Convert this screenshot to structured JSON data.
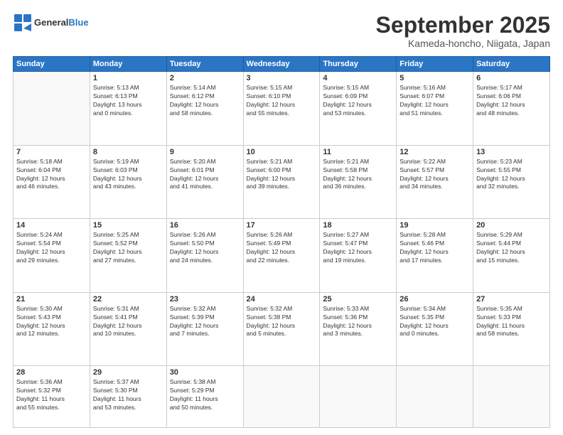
{
  "header": {
    "logo_general": "General",
    "logo_blue": "Blue",
    "month_title": "September 2025",
    "location": "Kameda-honcho, Niigata, Japan"
  },
  "weekdays": [
    "Sunday",
    "Monday",
    "Tuesday",
    "Wednesday",
    "Thursday",
    "Friday",
    "Saturday"
  ],
  "weeks": [
    [
      {
        "day": "",
        "info": ""
      },
      {
        "day": "1",
        "info": "Sunrise: 5:13 AM\nSunset: 6:13 PM\nDaylight: 13 hours\nand 0 minutes."
      },
      {
        "day": "2",
        "info": "Sunrise: 5:14 AM\nSunset: 6:12 PM\nDaylight: 12 hours\nand 58 minutes."
      },
      {
        "day": "3",
        "info": "Sunrise: 5:15 AM\nSunset: 6:10 PM\nDaylight: 12 hours\nand 55 minutes."
      },
      {
        "day": "4",
        "info": "Sunrise: 5:15 AM\nSunset: 6:09 PM\nDaylight: 12 hours\nand 53 minutes."
      },
      {
        "day": "5",
        "info": "Sunrise: 5:16 AM\nSunset: 6:07 PM\nDaylight: 12 hours\nand 51 minutes."
      },
      {
        "day": "6",
        "info": "Sunrise: 5:17 AM\nSunset: 6:06 PM\nDaylight: 12 hours\nand 48 minutes."
      }
    ],
    [
      {
        "day": "7",
        "info": "Sunrise: 5:18 AM\nSunset: 6:04 PM\nDaylight: 12 hours\nand 46 minutes."
      },
      {
        "day": "8",
        "info": "Sunrise: 5:19 AM\nSunset: 6:03 PM\nDaylight: 12 hours\nand 43 minutes."
      },
      {
        "day": "9",
        "info": "Sunrise: 5:20 AM\nSunset: 6:01 PM\nDaylight: 12 hours\nand 41 minutes."
      },
      {
        "day": "10",
        "info": "Sunrise: 5:21 AM\nSunset: 6:00 PM\nDaylight: 12 hours\nand 39 minutes."
      },
      {
        "day": "11",
        "info": "Sunrise: 5:21 AM\nSunset: 5:58 PM\nDaylight: 12 hours\nand 36 minutes."
      },
      {
        "day": "12",
        "info": "Sunrise: 5:22 AM\nSunset: 5:57 PM\nDaylight: 12 hours\nand 34 minutes."
      },
      {
        "day": "13",
        "info": "Sunrise: 5:23 AM\nSunset: 5:55 PM\nDaylight: 12 hours\nand 32 minutes."
      }
    ],
    [
      {
        "day": "14",
        "info": "Sunrise: 5:24 AM\nSunset: 5:54 PM\nDaylight: 12 hours\nand 29 minutes."
      },
      {
        "day": "15",
        "info": "Sunrise: 5:25 AM\nSunset: 5:52 PM\nDaylight: 12 hours\nand 27 minutes."
      },
      {
        "day": "16",
        "info": "Sunrise: 5:26 AM\nSunset: 5:50 PM\nDaylight: 12 hours\nand 24 minutes."
      },
      {
        "day": "17",
        "info": "Sunrise: 5:26 AM\nSunset: 5:49 PM\nDaylight: 12 hours\nand 22 minutes."
      },
      {
        "day": "18",
        "info": "Sunrise: 5:27 AM\nSunset: 5:47 PM\nDaylight: 12 hours\nand 19 minutes."
      },
      {
        "day": "19",
        "info": "Sunrise: 5:28 AM\nSunset: 5:46 PM\nDaylight: 12 hours\nand 17 minutes."
      },
      {
        "day": "20",
        "info": "Sunrise: 5:29 AM\nSunset: 5:44 PM\nDaylight: 12 hours\nand 15 minutes."
      }
    ],
    [
      {
        "day": "21",
        "info": "Sunrise: 5:30 AM\nSunset: 5:43 PM\nDaylight: 12 hours\nand 12 minutes."
      },
      {
        "day": "22",
        "info": "Sunrise: 5:31 AM\nSunset: 5:41 PM\nDaylight: 12 hours\nand 10 minutes."
      },
      {
        "day": "23",
        "info": "Sunrise: 5:32 AM\nSunset: 5:39 PM\nDaylight: 12 hours\nand 7 minutes."
      },
      {
        "day": "24",
        "info": "Sunrise: 5:32 AM\nSunset: 5:38 PM\nDaylight: 12 hours\nand 5 minutes."
      },
      {
        "day": "25",
        "info": "Sunrise: 5:33 AM\nSunset: 5:36 PM\nDaylight: 12 hours\nand 3 minutes."
      },
      {
        "day": "26",
        "info": "Sunrise: 5:34 AM\nSunset: 5:35 PM\nDaylight: 12 hours\nand 0 minutes."
      },
      {
        "day": "27",
        "info": "Sunrise: 5:35 AM\nSunset: 5:33 PM\nDaylight: 11 hours\nand 58 minutes."
      }
    ],
    [
      {
        "day": "28",
        "info": "Sunrise: 5:36 AM\nSunset: 5:32 PM\nDaylight: 11 hours\nand 55 minutes."
      },
      {
        "day": "29",
        "info": "Sunrise: 5:37 AM\nSunset: 5:30 PM\nDaylight: 11 hours\nand 53 minutes."
      },
      {
        "day": "30",
        "info": "Sunrise: 5:38 AM\nSunset: 5:29 PM\nDaylight: 11 hours\nand 50 minutes."
      },
      {
        "day": "",
        "info": ""
      },
      {
        "day": "",
        "info": ""
      },
      {
        "day": "",
        "info": ""
      },
      {
        "day": "",
        "info": ""
      }
    ]
  ]
}
